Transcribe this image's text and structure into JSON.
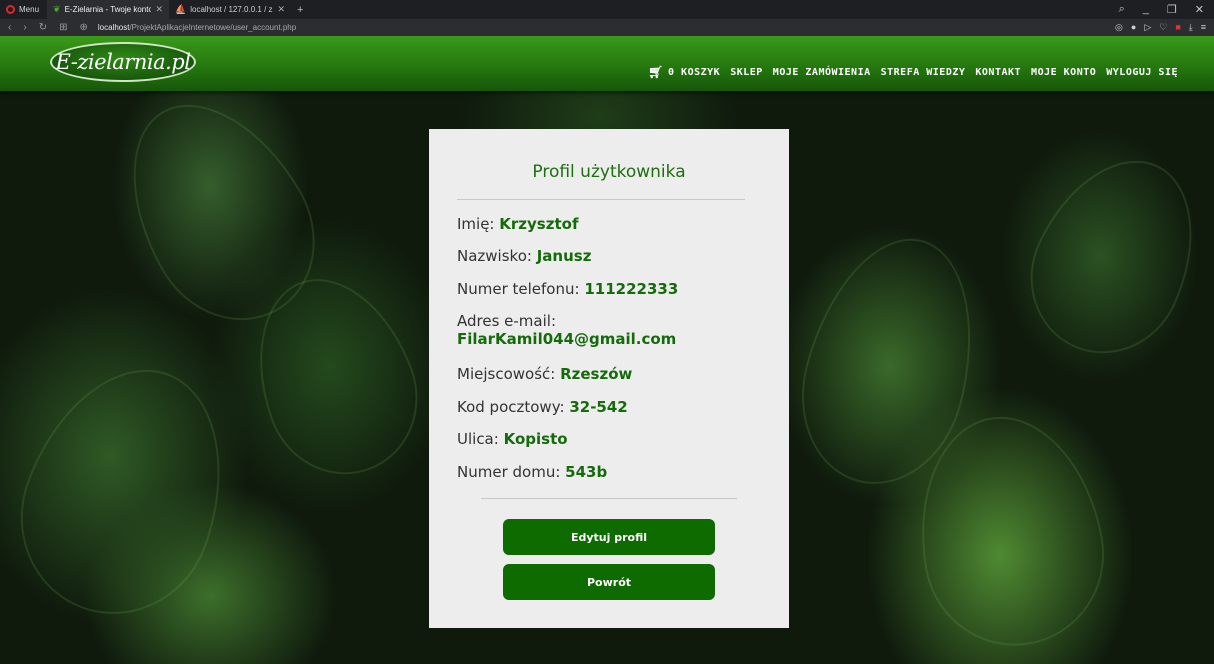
{
  "browser": {
    "menu_label": "Menu",
    "tabs": [
      {
        "title": "E-Zielarnia - Twoje konto",
        "icon": "leaf-icon",
        "active": true
      },
      {
        "title": "localhost / 127.0.0.1 / ziela",
        "icon": "phpmyadmin-icon",
        "active": false
      }
    ],
    "url_host": "localhost",
    "url_path": "/ProjektAplikacjeInternetowe/user_account.php"
  },
  "header": {
    "logo_text": "E-zielarnia.pl",
    "nav": {
      "cart_label": "0 KOSZYK",
      "shop": "SKLEP",
      "orders": "MOJE ZAMÓWIENIA",
      "knowledge": "STREFA WIEDZY",
      "contact": "KONTAKT",
      "account": "MOJE KONTO",
      "logout": "WYLOGUJ SIĘ"
    }
  },
  "profile": {
    "title": "Profil użytkownika",
    "fields": [
      {
        "label": "Imię:",
        "value": "Krzysztof"
      },
      {
        "label": "Nazwisko:",
        "value": "Janusz"
      },
      {
        "label": "Numer telefonu:",
        "value": "111222333"
      },
      {
        "label": "Adres e-mail:",
        "value": "FilarKamil044@gmail.com"
      },
      {
        "label": "Miejscowość:",
        "value": "Rzeszów"
      },
      {
        "label": "Kod pocztowy:",
        "value": "32-542"
      },
      {
        "label": "Ulica:",
        "value": "Kopisto"
      },
      {
        "label": "Numer domu:",
        "value": "543b"
      }
    ],
    "edit_button": "Edytuj profil",
    "back_button": "Powrót"
  },
  "colors": {
    "accent_green": "#156b0b",
    "button_green": "#0d6b00",
    "header_green": "#25780f"
  }
}
